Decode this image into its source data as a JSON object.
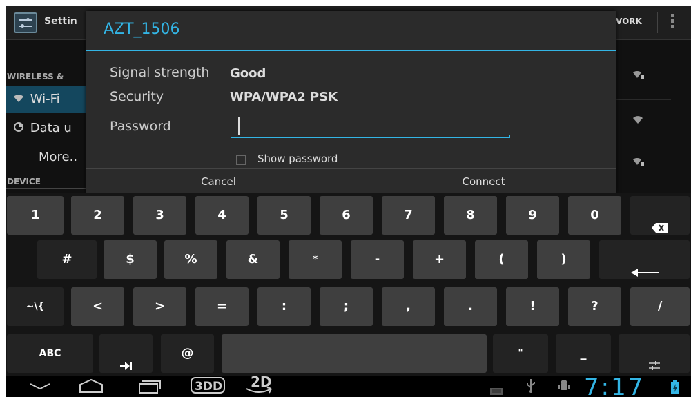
{
  "settings": {
    "title_visible": "Settin",
    "network_label_visible": "VORK",
    "left_pane": {
      "header_wireless": "WIRELESS &",
      "header_device": "DEVICE",
      "items": [
        {
          "label": "Wi-Fi",
          "icon": "wifi-icon"
        },
        {
          "label": "Data u",
          "icon": "data-usage-icon"
        },
        {
          "label": "More..",
          "icon": ""
        }
      ]
    }
  },
  "dialog": {
    "title": "AZT_1506",
    "signal_label": "Signal strength",
    "signal_value": "Good",
    "security_label": "Security",
    "security_value": "WPA/WPA2 PSK",
    "password_label": "Password",
    "password_value": "",
    "show_password_label": "Show password",
    "show_password_checked": false,
    "cancel_label": "Cancel",
    "connect_label": "Connect"
  },
  "keyboard": {
    "row1": [
      "1",
      "2",
      "3",
      "4",
      "5",
      "6",
      "7",
      "8",
      "9",
      "0"
    ],
    "row2": [
      "#",
      "$",
      "%",
      "&",
      "*",
      "-",
      "+",
      "(",
      ")"
    ],
    "row3": [
      "~\\{",
      "<",
      ">",
      "=",
      ":",
      ";",
      ",",
      ".",
      "!",
      "?",
      "/"
    ],
    "row4": {
      "abc": "ABC",
      "at": "@",
      "quote": "\"",
      "underscore": "_"
    }
  },
  "status": {
    "clock": "7:17",
    "accent_color": "#33b5e5"
  }
}
